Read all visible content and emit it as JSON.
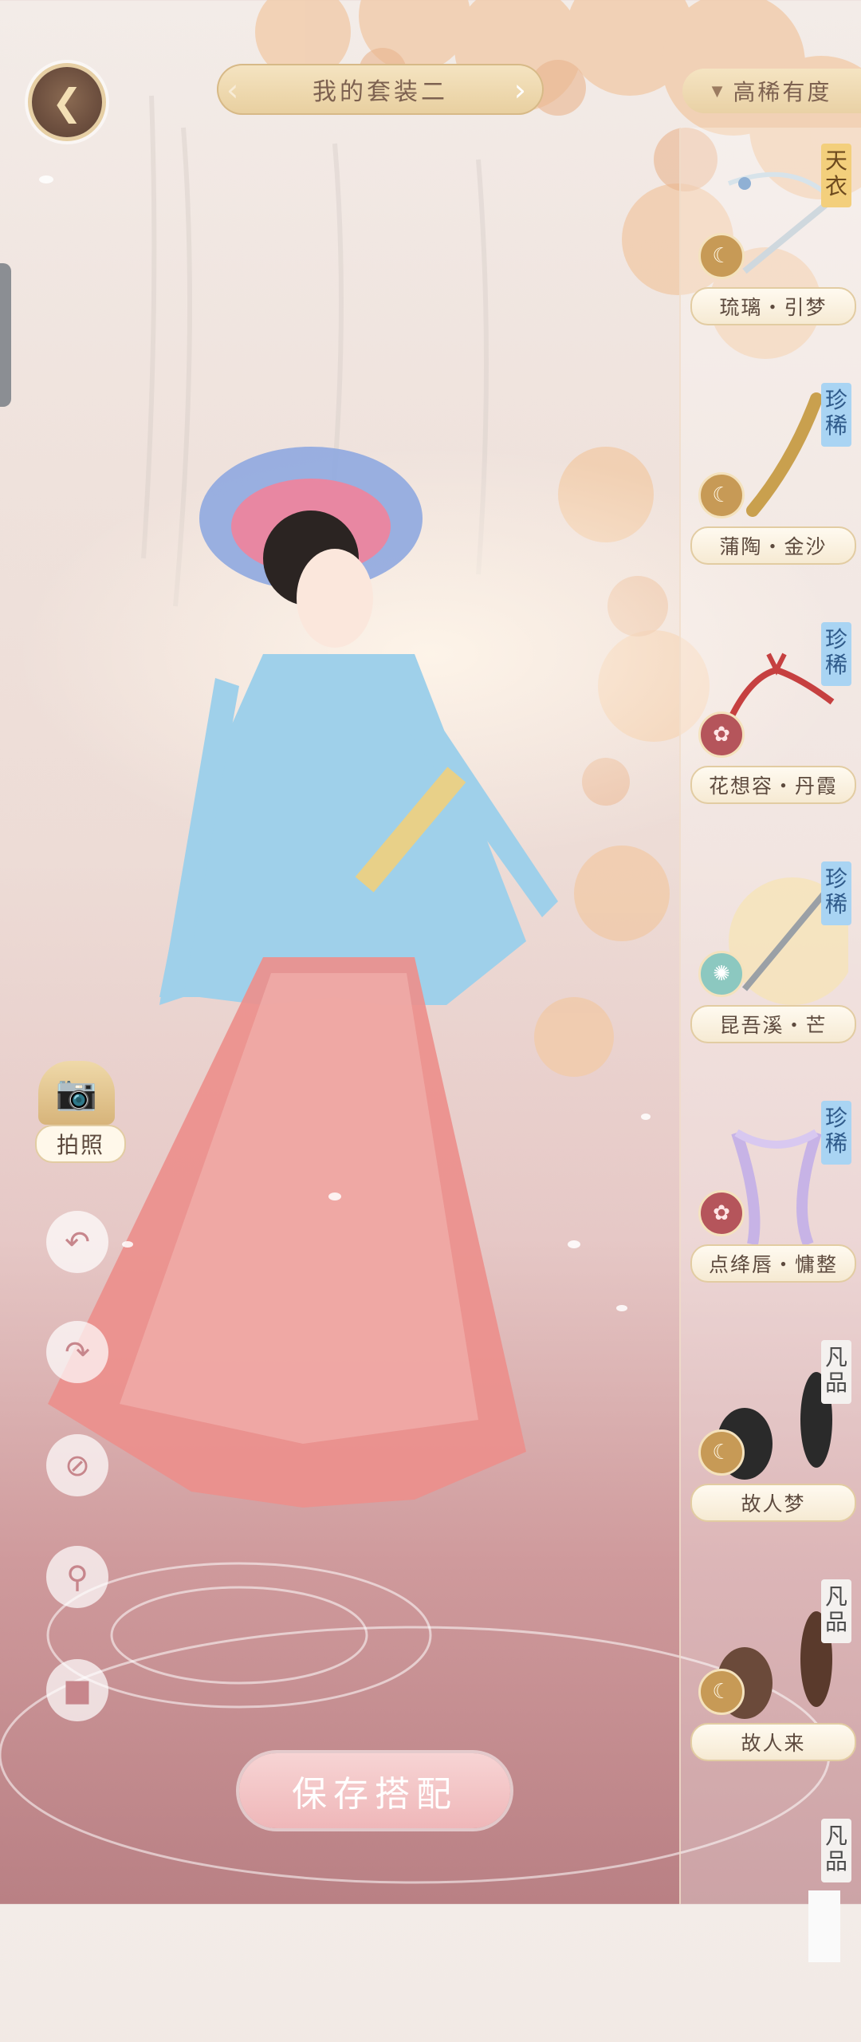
{
  "header": {
    "back_icon": "back-arrow-icon",
    "outfit_title": "我的套装二",
    "filter_label": "高稀有度"
  },
  "items": [
    {
      "name": "琉璃・引梦",
      "rarity": [
        "天",
        "衣"
      ],
      "rarity_class": "gold",
      "badge": "moon",
      "art": "ribbon-hairpin"
    },
    {
      "name": "蒲陶・金沙",
      "rarity": [
        "珍",
        "稀"
      ],
      "rarity_class": "blue",
      "badge": "moon",
      "art": "golden-hairpin"
    },
    {
      "name": "花想容・丹霞",
      "rarity": [
        "珍",
        "稀"
      ],
      "rarity_class": "blue",
      "badge": "lotus",
      "art": "red-ribbon"
    },
    {
      "name": "昆吾溪・芒",
      "rarity": [
        "珍",
        "稀"
      ],
      "rarity_class": "blue",
      "badge": "wind",
      "art": "sword"
    },
    {
      "name": "点绛唇・慵整",
      "rarity": [
        "珍",
        "稀"
      ],
      "rarity_class": "blue",
      "badge": "lotus",
      "art": "purple-ribbon"
    },
    {
      "name": "故人梦",
      "rarity": [
        "凡",
        "品"
      ],
      "rarity_class": "plain",
      "badge": "moon",
      "art": "black-ears"
    },
    {
      "name": "故人来",
      "rarity": [
        "凡",
        "品"
      ],
      "rarity_class": "plain",
      "badge": "moon",
      "art": "brown-ears"
    },
    {
      "name": "",
      "rarity": [
        "凡",
        "品"
      ],
      "rarity_class": "plain",
      "badge": "",
      "art": "white-item"
    }
  ],
  "tools": {
    "camera_label": "拍照",
    "undo_icon": "undo-icon",
    "redo_icon": "redo-icon",
    "clear_icon": "ban-icon",
    "zoom_icon": "magnifier-icon",
    "delete_icon": "trash-icon"
  },
  "save_label": "保存搭配",
  "colors": {
    "gold": "#e8cf9f",
    "text_brown": "#7d6150",
    "save_pink": "#efb7b9"
  }
}
